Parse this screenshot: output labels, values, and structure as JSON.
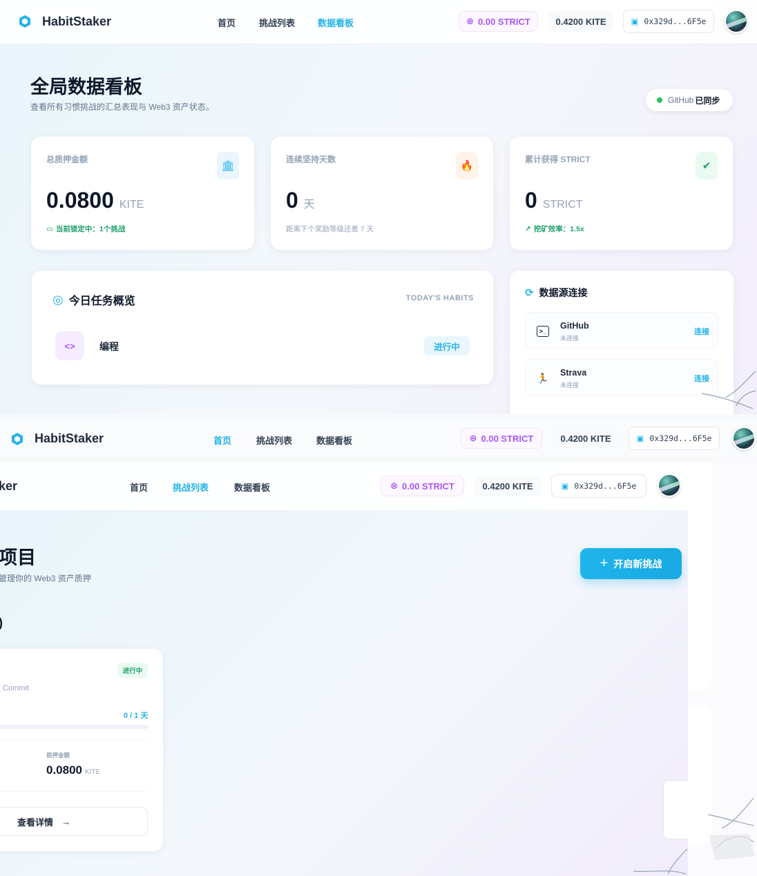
{
  "brand": "HabitStaker",
  "nav": {
    "home": "首页",
    "challenges": "挑战列表",
    "dashboard": "数据看板"
  },
  "wallet": {
    "strict": "0.00 STRICT",
    "kite": "0.4200 KITE",
    "address": "0x329d...6F5e"
  },
  "dashboard": {
    "title": "全局数据看板",
    "subtitle": "查看所有习惯挑战的汇总表现与 Web3 资产状态。",
    "sync_prefix": "GitHub",
    "sync_status": "已同步",
    "stats": [
      {
        "label": "总质押金额",
        "value": "0.0800",
        "unit": "KITE",
        "foot": "当前锁定中：1个挑战",
        "icon": "bank-icon",
        "color": "#22a06b"
      },
      {
        "label": "连续坚持天数",
        "value": "0",
        "unit": "天",
        "foot": "距离下个奖励等级还差 7 天",
        "icon": "flame-icon",
        "color": "#94a3b8"
      },
      {
        "label": "累计获得 STRICT",
        "value": "0",
        "unit": "STRICT",
        "foot": "挖矿效率：1.5x",
        "icon": "verified-badge-icon",
        "color": "#22a06b"
      }
    ],
    "today": {
      "title": "今日任务概览",
      "tag": "TODAY'S HABITS",
      "habit_name": "编程",
      "habit_status": "进行中",
      "habit_icon": "code-icon"
    },
    "sources": {
      "title": "数据源连接",
      "items": [
        {
          "name": "GitHub",
          "status": "未连接",
          "action": "连接",
          "icon": "terminal-icon"
        },
        {
          "name": "Strava",
          "status": "未连接",
          "action": "连接",
          "icon": "running-icon"
        }
      ]
    }
  },
  "challenges": {
    "title_fragment": "项目",
    "subtitle_fragment": "管理你的 Web3 资产质押",
    "section_fragment": ")",
    "new_button": "开启新挑战",
    "card": {
      "status": "进行中",
      "desc_fragment": "次 Commit",
      "progress_text": "0 / 1 天",
      "progress_fraction": 0.0,
      "stake_label": "质押金额",
      "stake_value": "0.0800",
      "stake_unit": "KITE",
      "detail_button": "查看详情"
    },
    "brand_fragment": "ker"
  },
  "colors": {
    "accent": "#22b3e8",
    "purple": "#a855f7",
    "green": "#22a06b",
    "orange": "#f97316"
  }
}
